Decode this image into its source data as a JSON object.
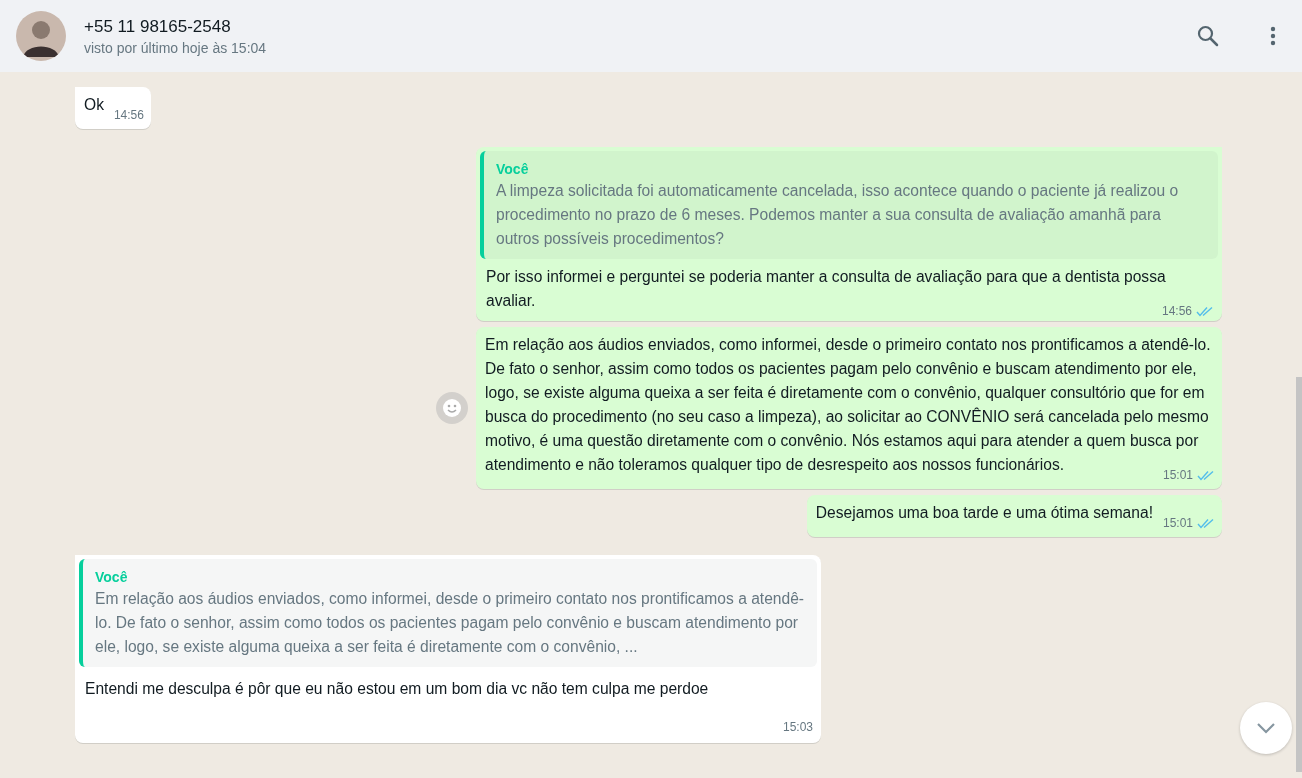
{
  "header": {
    "contact": "+55 11 98165-2548",
    "status": "visto por último hoje às 15:04"
  },
  "messages": [
    {
      "kind": "incoming",
      "text": "Ok",
      "time": "14:56"
    },
    {
      "kind": "outgoing",
      "quote": {
        "author": "Você",
        "text": "A limpeza solicitada foi automaticamente cancelada, isso acontece quando o paciente já realizou o procedimento no prazo de 6 meses. Podemos manter a sua consulta de avaliação amanhã para outros possíveis procedimentos?"
      },
      "text": "Por isso informei e perguntei se poderia manter a consulta de avaliação para que a dentista possa avaliar.",
      "time": "14:56",
      "read": true
    },
    {
      "kind": "outgoing",
      "text": "Em relação aos áudios enviados, como informei, desde o primeiro contato nos prontificamos a atendê-lo. De fato o senhor, assim como todos os pacientes pagam pelo convênio e buscam atendimento por ele, logo, se existe alguma queixa a ser feita é diretamente com o convênio, qualquer consultório que for em busca do procedimento (no seu caso a limpeza), ao solicitar ao CONVÊNIO será cancelada pelo mesmo motivo, é uma questão diretamente com o convênio. Nós estamos aqui para atender a quem busca por atendimento e não toleramos qualquer tipo de desrespeito aos nossos funcionários.",
      "time": "15:01",
      "read": true,
      "react": true
    },
    {
      "kind": "outgoing",
      "text": "Desejamos uma boa tarde e uma ótima semana!",
      "time": "15:01",
      "read": true
    },
    {
      "kind": "incoming",
      "quote": {
        "author": "Você",
        "text": "Em relação aos áudios enviados, como informei, desde o primeiro contato nos prontificamos a atendê-lo. De fato o senhor, assim como todos os pacientes pagam pelo convênio e buscam atendimento por ele, logo, se existe alguma queixa a ser feita é diretamente com o convênio, ..."
      },
      "text": "Entendi me desculpa é pôr que eu não estou em um bom dia vc não tem culpa me perdoe",
      "time": "15:03",
      "time_below": true
    }
  ]
}
